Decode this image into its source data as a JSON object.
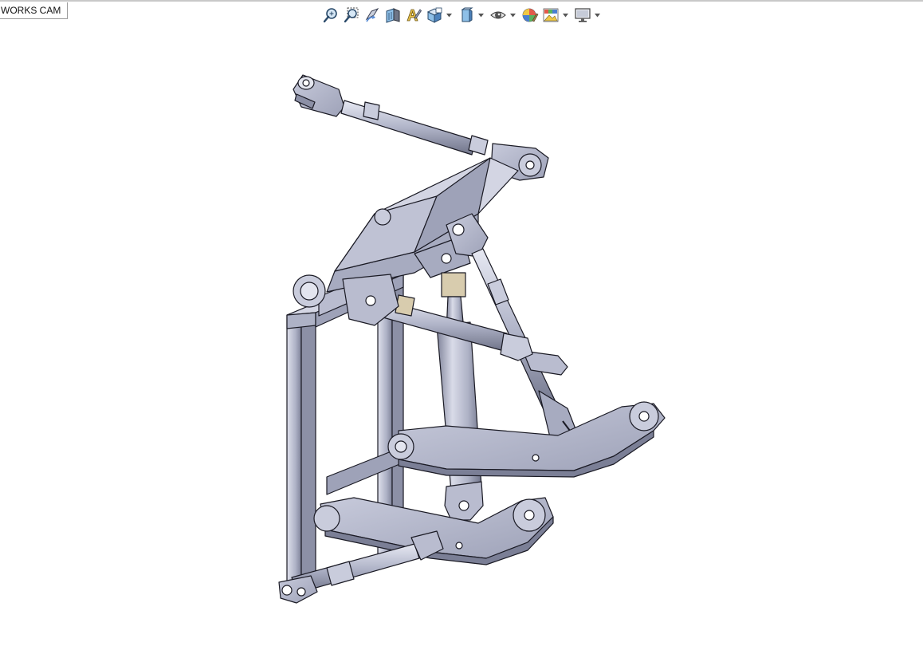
{
  "app": {
    "tab_label": "WORKS CAM"
  },
  "toolbar": {
    "items": [
      {
        "icon": "zoom-to-fit-icon"
      },
      {
        "icon": "zoom-to-area-icon"
      },
      {
        "icon": "previous-view-icon"
      },
      {
        "icon": "section-view-icon"
      },
      {
        "icon": "dynamic-annotation-views-icon"
      },
      {
        "icon": "view-orientation-icon",
        "dropdown": true
      },
      {
        "icon": "display-style-icon",
        "dropdown": true
      },
      {
        "icon": "hide-show-items-icon",
        "dropdown": true
      },
      {
        "icon": "edit-appearance-icon"
      },
      {
        "icon": "apply-scene-icon",
        "dropdown": true
      },
      {
        "icon": "view-settings-icon",
        "dropdown": true
      }
    ]
  },
  "viewport": {
    "model": "three-point-hitch-linkage-assembly",
    "colors": {
      "part": "#b4b8cc",
      "part_dark": "#7b7f96",
      "part_light": "#dadcea",
      "edge": "#1a1a24",
      "nut": "#d8ccae",
      "background": "#ffffff"
    }
  }
}
